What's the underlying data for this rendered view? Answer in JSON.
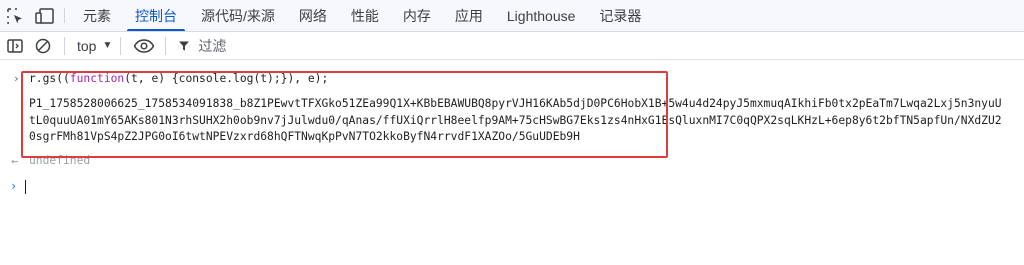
{
  "tabs": [
    {
      "label": "元素"
    },
    {
      "label": "控制台"
    },
    {
      "label": "源代码/来源"
    },
    {
      "label": "网络"
    },
    {
      "label": "性能"
    },
    {
      "label": "内存"
    },
    {
      "label": "应用"
    },
    {
      "label": "Lighthouse"
    },
    {
      "label": "记录器"
    }
  ],
  "toolbar": {
    "context": "top",
    "filter_placeholder": "过滤"
  },
  "console": {
    "input": {
      "prefix": "r.gs((",
      "keyword": "function",
      "params": "(t, e) {console.log(t);}), e);"
    },
    "output_lines": [
      "P1_1758528006625_1758534091838_b8Z1PEwvtTFXGko51ZEa99Q1X+KBbEBAWUBQ8pyrVJH16KAb5djD0PC6HobX1B+5w4u4d24pyJ5mxmuqAIkhiFb0tx2pEaTm7Lwqa2Lxj5n3nyuU",
      "tL0quuUA01mY65AKs801N3rhSUHX2h0ob9nv7jJulwdu0/qAnas/ffUXiQrrlH8eelfp9AM+75cHSwBG7Eks1zs4nHxG1EsQluxnMI7C0qQPX2sqLKHzL+6ep8y6t2bfTN5apfUn/NXdZU2",
      "0sgrFMh81VpS4pZ2JPG0oI6twtNPEVzxrd68hQFTNwqKpPvN7TO2kkoByfN4rrvdF1XAZOo/5GuUDEb9H"
    ],
    "result": "undefined"
  },
  "colors": {
    "accent": "#0b57d0",
    "highlight_box": "#e03c3c",
    "keyword": "#a626a4"
  }
}
